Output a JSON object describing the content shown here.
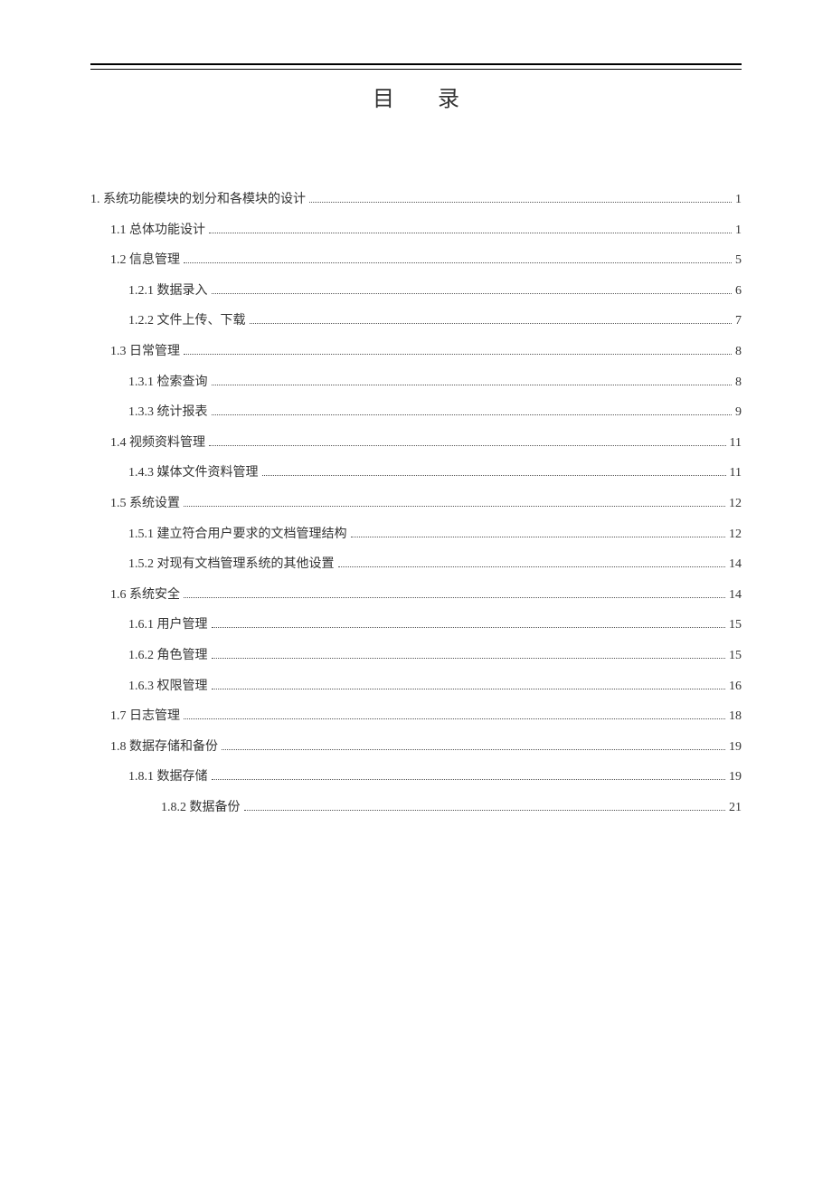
{
  "title": "目录",
  "toc": [
    {
      "indent": 0,
      "label": "1.  系统功能模块的划分和各模块的设计",
      "page": "1"
    },
    {
      "indent": 1,
      "label": "1.1 总体功能设计",
      "page": "1"
    },
    {
      "indent": 1,
      "label": "1.2  信息管理",
      "page": "5"
    },
    {
      "indent": 2,
      "label": "1.2.1   数据录入",
      "page": "6"
    },
    {
      "indent": 2,
      "label": "1.2.2   文件上传、下载",
      "page": "7"
    },
    {
      "indent": 1,
      "label": "1.3 日常管理",
      "page": "8"
    },
    {
      "indent": 2,
      "label": "1.3.1   检索查询",
      "page": "8"
    },
    {
      "indent": 2,
      "label": "1.3.3 统计报表",
      "page": "9"
    },
    {
      "indent": 1,
      "label": "1.4 视频资料管理",
      "page": "11"
    },
    {
      "indent": 2,
      "label": "1.4.3 媒体文件资料管理",
      "page": "11"
    },
    {
      "indent": 1,
      "label": "1.5 系统设置",
      "page": "12"
    },
    {
      "indent": 2,
      "label": "1.5.1 建立符合用户要求的文档管理结构",
      "page": "12"
    },
    {
      "indent": 2,
      "label": "1.5.2 对现有文档管理系统的其他设置",
      "page": "14"
    },
    {
      "indent": 1,
      "label": "1.6 系统安全",
      "page": "14"
    },
    {
      "indent": 2,
      "label": "1.6.1 用户管理",
      "page": "15"
    },
    {
      "indent": 2,
      "label": "1.6.2 角色管理",
      "page": "15"
    },
    {
      "indent": 2,
      "label": "1.6.3 权限管理",
      "page": "16"
    },
    {
      "indent": 1,
      "label": "1.7 日志管理",
      "page": "18"
    },
    {
      "indent": 1,
      "label": "1.8 数据存储和备份",
      "page": "19"
    },
    {
      "indent": 2,
      "label": "1.8.1 数据存储",
      "page": "19"
    },
    {
      "indent": 3,
      "label": "1.8.2 数据备份",
      "page": "21"
    }
  ]
}
